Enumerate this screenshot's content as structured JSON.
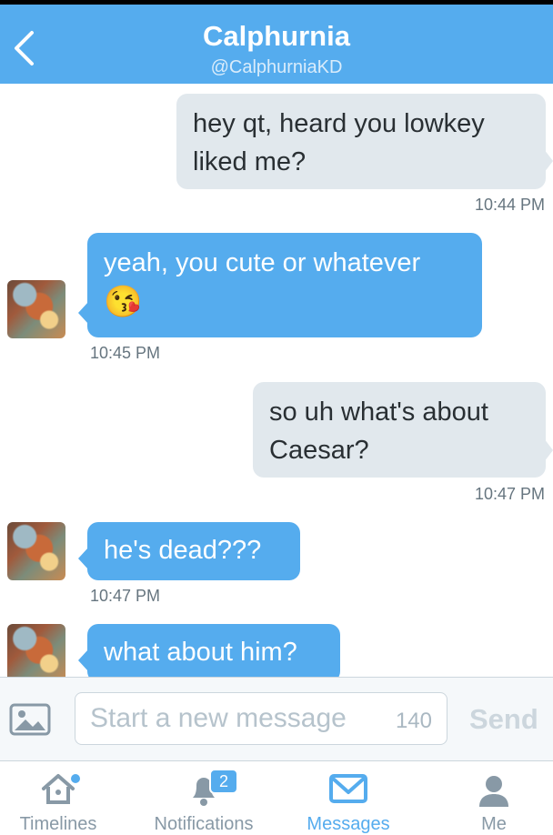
{
  "header": {
    "title": "Calphurnia",
    "handle": "@CalphurniaKD"
  },
  "messages": [
    {
      "direction": "sent",
      "lines": [
        "hey qt, heard you lowkey",
        "liked me?"
      ],
      "time": "10:44 PM"
    },
    {
      "direction": "received",
      "lines": [
        "yeah, you cute or whatever"
      ],
      "emoji": "😘",
      "time": "10:45 PM"
    },
    {
      "direction": "sent",
      "lines": [
        "so uh what's about",
        "Caesar?"
      ],
      "time": "10:47 PM"
    },
    {
      "direction": "received",
      "lines": [
        "he's dead???"
      ],
      "time": "10:47 PM"
    },
    {
      "direction": "received",
      "lines": [
        "what about him?"
      ],
      "time": ""
    }
  ],
  "composer": {
    "placeholder": "Start a new message",
    "counter": "140",
    "send_label": "Send"
  },
  "tabs": [
    {
      "label": "Timelines",
      "icon": "home-icon"
    },
    {
      "label": "Notifications",
      "icon": "bell-icon",
      "badge": "2"
    },
    {
      "label": "Messages",
      "icon": "envelope-icon",
      "active": true
    },
    {
      "label": "Me",
      "icon": "person-icon"
    }
  ],
  "colors": {
    "accent": "#55acee",
    "sent_bubble": "#e1e8ed",
    "received_bubble": "#55acee"
  }
}
